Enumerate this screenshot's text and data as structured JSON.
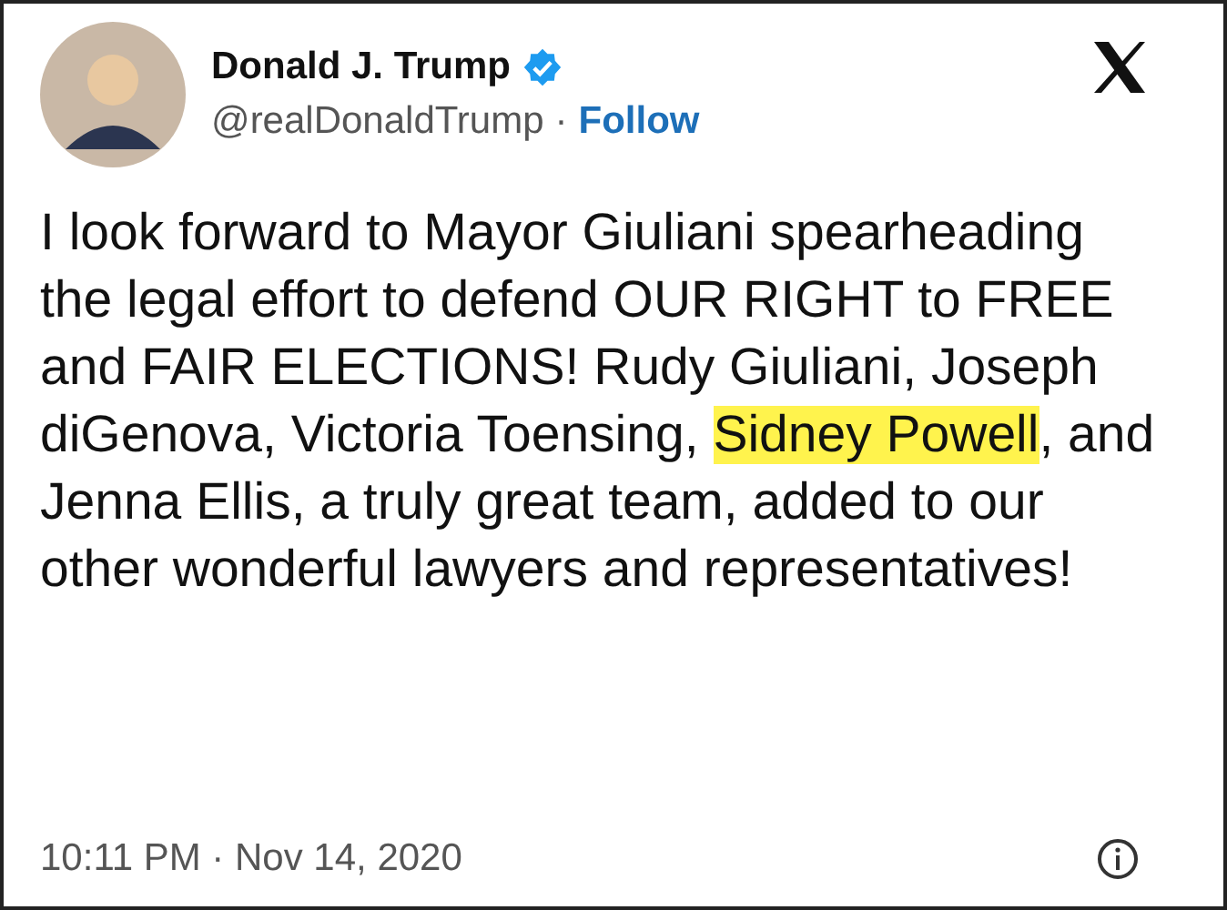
{
  "author": {
    "name": "Donald J. Trump",
    "verified": true,
    "handle": "@realDonaldTrump",
    "separator": "·",
    "follow": "Follow"
  },
  "tweet": {
    "segments": [
      {
        "text": "I look forward to Mayor Giuliani spearheading the legal effort to defend OUR RIGHT to FREE and FAIR ELECTIONS! Rudy Giuliani, Joseph diGenova, Victoria Toensing, ",
        "highlighted": false
      },
      {
        "text": "Sidney Powell",
        "highlighted": true
      },
      {
        "text": ", and Jenna Ellis, a truly great team, added to our other wonderful lawyers and representatives!",
        "highlighted": false
      }
    ]
  },
  "footer": {
    "timestamp": "10:11 PM · Nov 14, 2020"
  }
}
